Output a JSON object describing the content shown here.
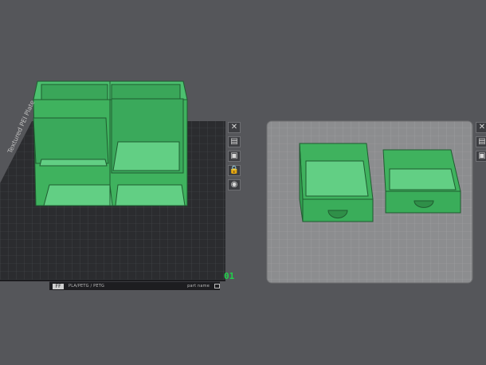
{
  "plates": [
    {
      "label": "01",
      "bed_brand": "FF",
      "bed_text": "PLA/PETG / PETG",
      "bed_secondary": "part name",
      "edge_text": "Textured PEI Plate",
      "tools": [
        {
          "icon": "close-icon",
          "glyph": "✕"
        },
        {
          "icon": "arrange-icon",
          "glyph": "▤"
        },
        {
          "icon": "orient-icon",
          "glyph": "▣"
        },
        {
          "icon": "lock-icon",
          "glyph": "🔒"
        },
        {
          "icon": "eye-icon",
          "glyph": "◉"
        }
      ]
    },
    {
      "label": "",
      "tools": [
        {
          "icon": "close-icon",
          "glyph": "✕"
        },
        {
          "icon": "arrange-icon",
          "glyph": "▤"
        },
        {
          "icon": "orient-icon",
          "glyph": "▣"
        }
      ]
    }
  ],
  "colors": {
    "background": "#55565a",
    "plate_dark": "#2b2c2f",
    "plate_light": "#8c8d8f",
    "model_green": "#3fb25e",
    "model_green_light": "#62cf84",
    "model_outline": "#1f5c30",
    "plate_label": "#1fd14a"
  }
}
